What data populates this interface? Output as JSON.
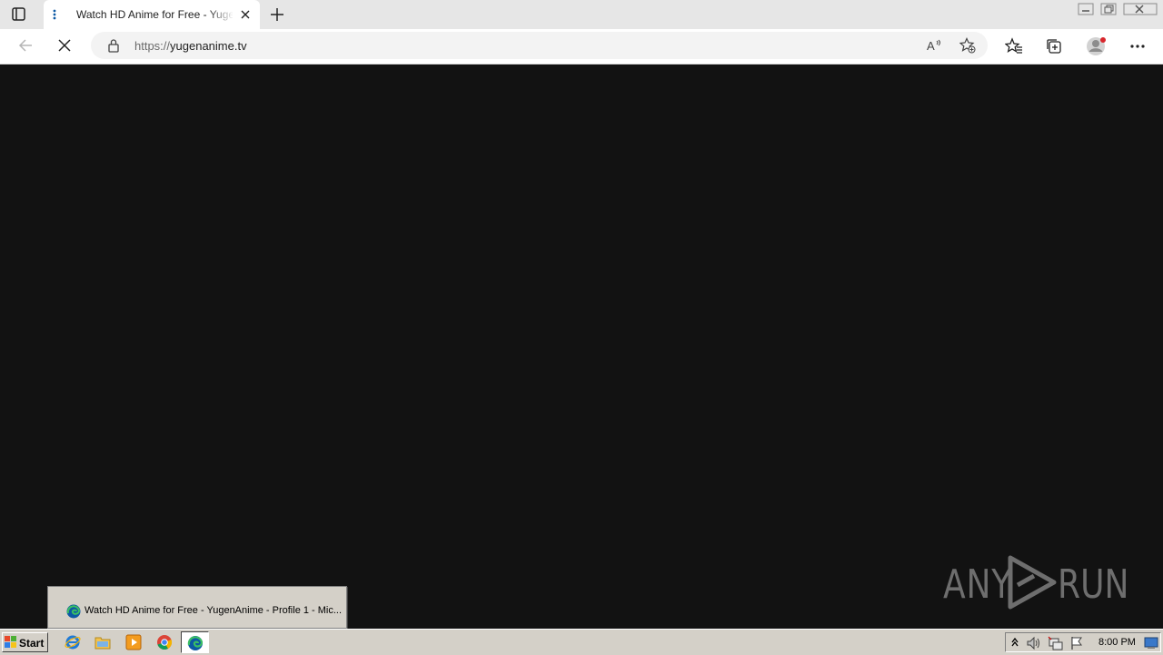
{
  "browser": {
    "tab": {
      "title": "Watch HD Anime for Free - YugenAnime"
    },
    "address": {
      "protocol": "https://",
      "domain": "yugenanime.tv"
    }
  },
  "taskbar": {
    "start_label": "Start",
    "window_preview": "Watch HD Anime for Free - YugenAnime - Profile 1 - Mic...",
    "clock": "8:00 PM",
    "pinned": [
      "internet-explorer-icon",
      "file-explorer-icon",
      "media-player-icon",
      "chrome-icon",
      "edge-icon"
    ]
  },
  "watermark": {
    "left": "ANY",
    "right": "RUN"
  },
  "colors": {
    "content_bg": "#121212",
    "taskbar_bg": "#d4d0c8",
    "edge_blue": "#0c59a4",
    "edge_green": "#3bbf63"
  }
}
